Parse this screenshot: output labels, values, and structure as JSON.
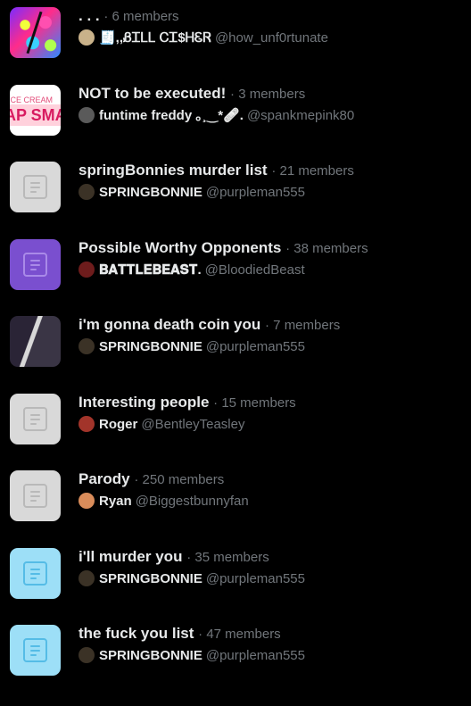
{
  "lists": [
    {
      "name": ". . .",
      "members": "· 6 members",
      "owner_display": "🧾,,ᏰᏆᏞᏞ ᏟᏆ$ᎻᏋᏒ",
      "owner_handle": "@how_unf0rtunate",
      "thumbnail": "art-photo",
      "avatar_color": "#c9b28a"
    },
    {
      "name": "NOT to be executed!",
      "members": "· 3 members",
      "owner_display": "funtime freddy ｡¸‿*🩹.",
      "owner_handle": "@spankmepink80",
      "thumbnail": "ice-cream-sign-photo",
      "thumbnail_text_small": "ICE CREAM",
      "thumbnail_text_big": "AP SMA",
      "avatar_color": "#5a5a5a"
    },
    {
      "name": "springBonnies murder list",
      "members": "· 21 members",
      "owner_display": "SPRINGBONNIE",
      "owner_handle": "@purpleman555",
      "thumbnail": "doc-icon-gray",
      "avatar_color": "#3b3226"
    },
    {
      "name": "Possible Worthy Opponents",
      "members": "· 38 members",
      "owner_display": "𝐁𝐀𝐓𝐓𝐋𝐄𝐁𝐄𝐀𝐒𝐓.",
      "owner_handle": "@BloodiedBeast",
      "thumbnail": "doc-icon-purple",
      "avatar_color": "#6e1c1c"
    },
    {
      "name": "i'm gonna death coin you",
      "members": "· 7 members",
      "owner_display": "SPRINGBONNIE",
      "owner_handle": "@purpleman555",
      "thumbnail": "dark-photo",
      "avatar_color": "#3b3226"
    },
    {
      "name": "Interesting people",
      "members": "· 15 members",
      "owner_display": "Roger",
      "owner_handle": "@BentleyTeasley",
      "thumbnail": "doc-icon-gray",
      "avatar_color": "#a2342a"
    },
    {
      "name": "Parody",
      "members": "· 250 members",
      "owner_display": "Ryan",
      "owner_handle": "@Biggestbunnyfan",
      "thumbnail": "doc-icon-gray",
      "avatar_color": "#d98c5a"
    },
    {
      "name": "i'll murder you",
      "members": "· 35 members",
      "owner_display": "SPRINGBONNIE",
      "owner_handle": "@purpleman555",
      "thumbnail": "doc-icon-cyan",
      "avatar_color": "#3b3226"
    },
    {
      "name": "the fuck you list",
      "members": "· 47 members",
      "owner_display": "SPRINGBONNIE",
      "owner_handle": "@purpleman555",
      "thumbnail": "doc-icon-cyan",
      "avatar_color": "#3b3226"
    }
  ]
}
